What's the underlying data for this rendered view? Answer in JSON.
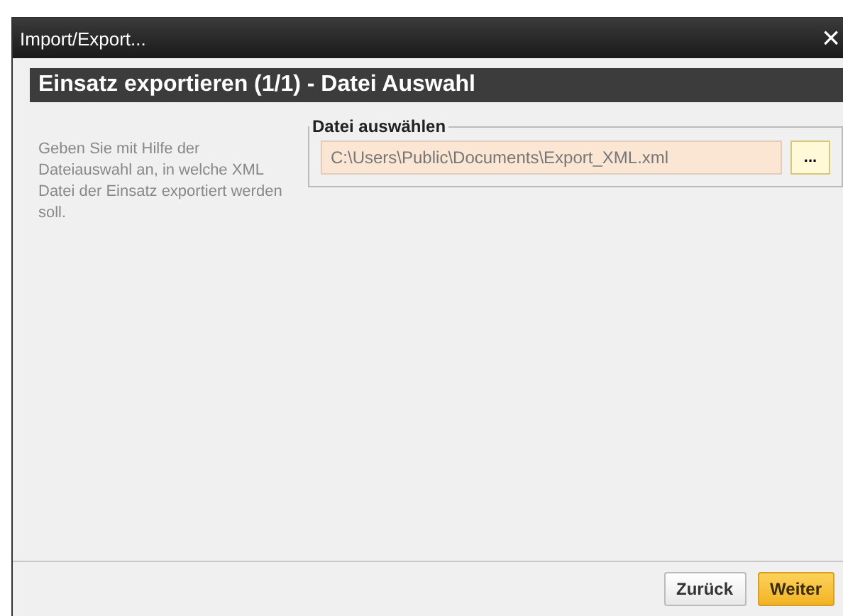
{
  "window": {
    "title": "Import/Export...",
    "close": "×"
  },
  "header": "Einsatz exportieren (1/1) - Datei Auswahl",
  "help_text": "Geben Sie mit Hilfe der Dateiauswahl an, in welche XML Datei der Einsatz exportiert werden soll.",
  "file_group": {
    "legend": "Datei auswählen",
    "value": "C:\\Users\\Public\\Documents\\Export_XML.xml",
    "browse": "..."
  },
  "buttons": [
    {
      "label": "Zurück",
      "primary": false
    },
    {
      "label": "Weiter",
      "primary": true
    }
  ]
}
